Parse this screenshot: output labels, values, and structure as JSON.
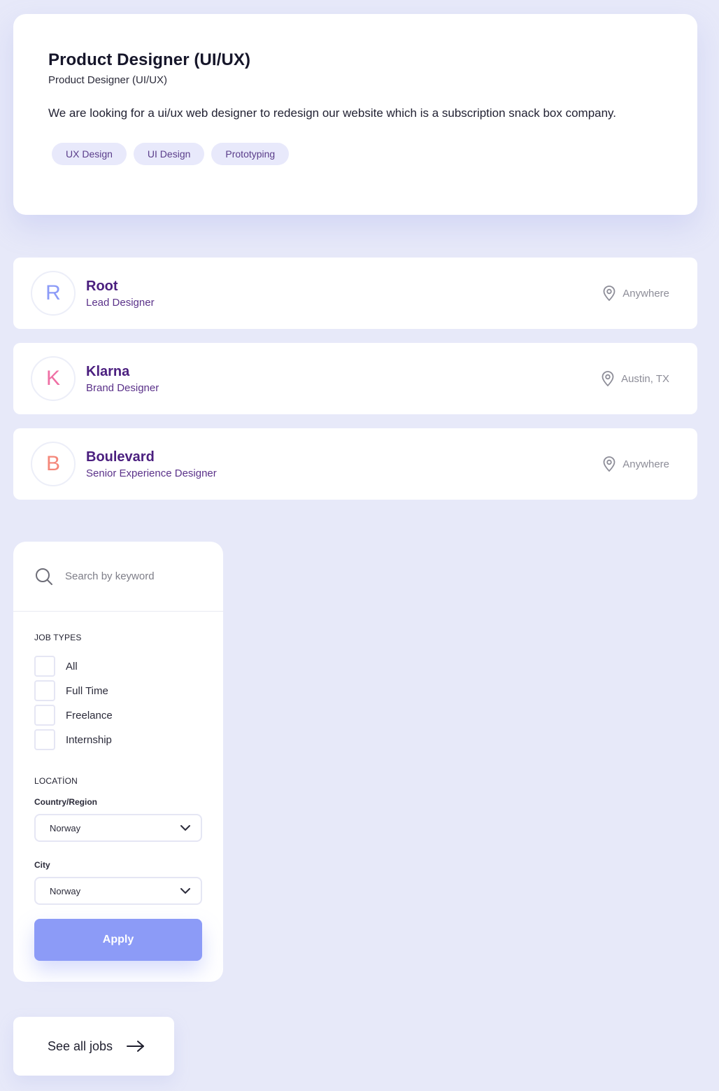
{
  "job": {
    "title": "Product Designer (UI/UX)",
    "subtitle": "Product Designer (UI/UX)",
    "description": "We are looking for a ui/ux web designer to redesign our website which is a subscription snack box company.",
    "tags": [
      "UX Design",
      "UI Design",
      "Prototyping"
    ]
  },
  "companies": [
    {
      "initial": "R",
      "name": "Root",
      "role": "Lead Designer",
      "location": "Anywhere",
      "color": "#8c9bf7"
    },
    {
      "initial": "K",
      "name": "Klarna",
      "role": "Brand Designer",
      "location": "Austin, TX",
      "color": "#ef6fa4"
    },
    {
      "initial": "B",
      "name": "Boulevard",
      "role": "Senior Experience Designer",
      "location": "Anywhere",
      "color": "#f4877a"
    }
  ],
  "filters": {
    "search_placeholder": "Search by keyword",
    "job_types_label": "JOB TYPES",
    "job_types": [
      "All",
      "Full Time",
      "Freelance",
      "Internship"
    ],
    "location_label": "LOCATİON",
    "country_label": "Country/Region",
    "country_value": "Norway",
    "city_label": "City",
    "city_value": "Norway",
    "apply_label": "Apply"
  },
  "see_all": {
    "label": "See all jobs"
  },
  "colors": {
    "background": "#e7e9f9",
    "accent": "#8c9bf7",
    "company_text": "#4b1f7f"
  }
}
